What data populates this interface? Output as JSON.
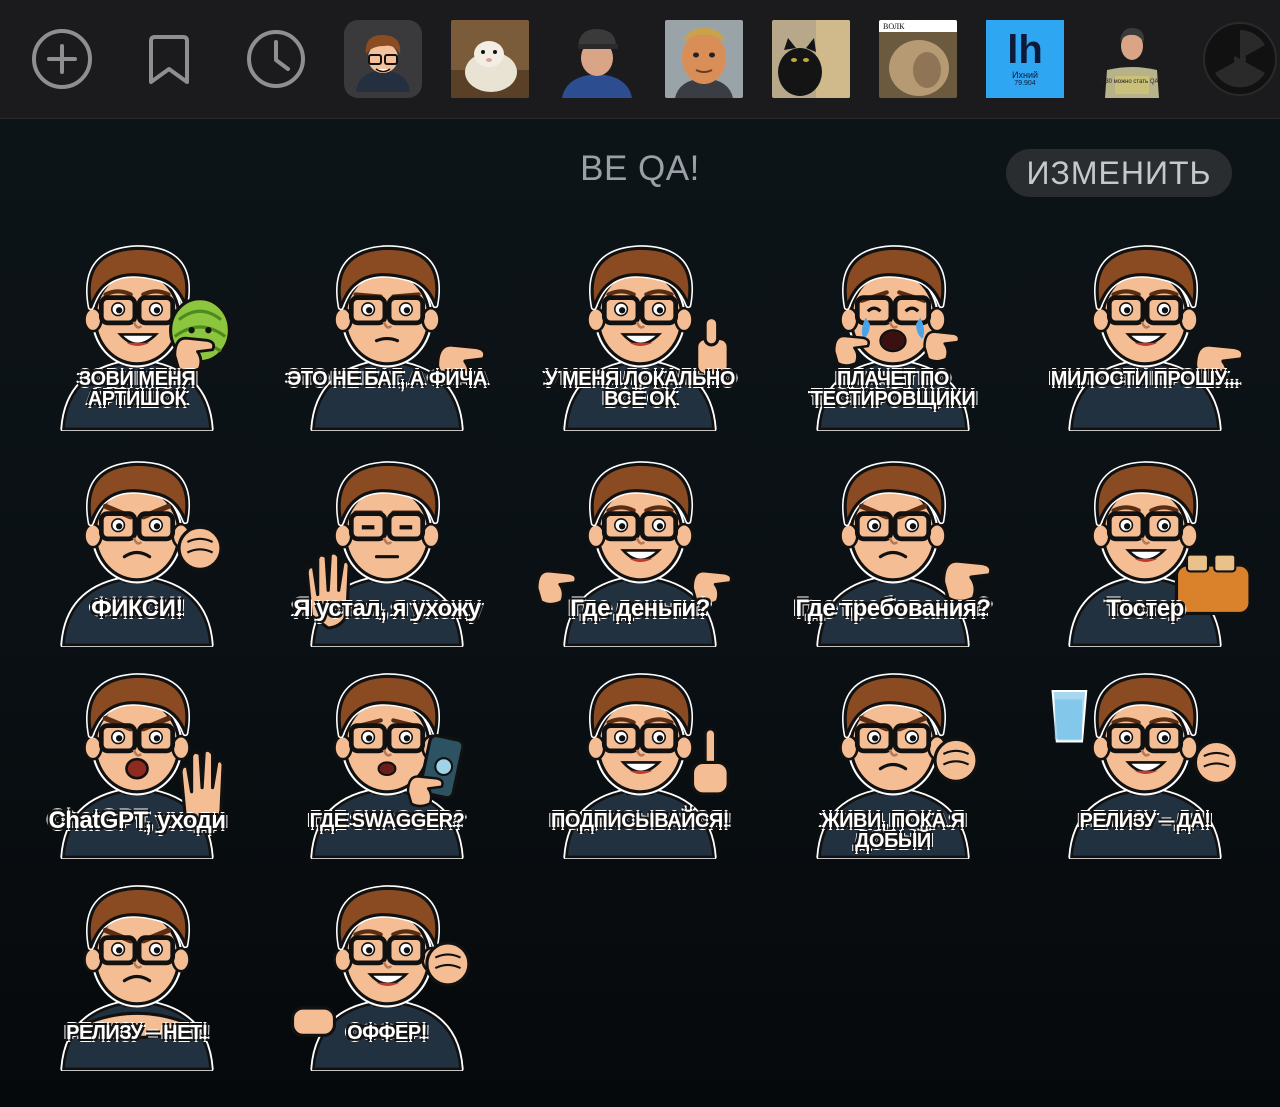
{
  "toolbar": {
    "items": [
      {
        "name": "add-pack-icon",
        "kind": "icon"
      },
      {
        "name": "saved-stickers-icon",
        "kind": "icon"
      },
      {
        "name": "recent-stickers-icon",
        "kind": "icon"
      },
      {
        "name": "pack-be-qa",
        "kind": "pack"
      },
      {
        "name": "pack-opossum",
        "kind": "pack"
      },
      {
        "name": "pack-man-cap",
        "kind": "pack"
      },
      {
        "name": "pack-mr-incredible",
        "kind": "pack"
      },
      {
        "name": "pack-cats",
        "kind": "pack"
      },
      {
        "name": "pack-wolf",
        "kind": "pack"
      },
      {
        "name": "pack-lh",
        "kind": "pack"
      },
      {
        "name": "pack-qa-man",
        "kind": "pack"
      },
      {
        "name": "radiation-icon",
        "kind": "icon"
      }
    ],
    "wolf_label": "ВОЛК",
    "lh_symbol": "lh",
    "lh_name": "Ихний",
    "lh_number": "79.904",
    "qa_shirt_text": "в 30 можно стать QA?!"
  },
  "pack": {
    "title": "BE QA!",
    "edit_label": "ИЗМЕНИТЬ"
  },
  "stickers": [
    {
      "caption": "ЗОВИ МЕНЯ АРТИШОК",
      "style": "upper",
      "prop": "artichoke",
      "mood": "happy"
    },
    {
      "caption": "ЭТО НЕ БАГ, А ФИЧА",
      "style": "upper",
      "prop": "palm",
      "mood": "neutral"
    },
    {
      "caption": "У МЕНЯ ЛОКАЛЬНО ВСЁ ОК",
      "style": "upper",
      "prop": "thumb",
      "mood": "happy"
    },
    {
      "caption": "ПЛАЧЕТ ПО ТЕСТИРОВЩИКИ",
      "style": "upper",
      "prop": "hands",
      "mood": "cry"
    },
    {
      "caption": "МИЛОСТИ ПРОШУ...",
      "style": "upper",
      "prop": "palm",
      "mood": "happy"
    },
    {
      "caption": "ФИКСИ!",
      "style": "lower",
      "prop": "fist",
      "mood": "angry"
    },
    {
      "caption": "Я устал, я ухожу",
      "style": "lower",
      "prop": "wave",
      "mood": "tired"
    },
    {
      "caption": "Где деньги?",
      "style": "lower",
      "prop": "shrug",
      "mood": "happy"
    },
    {
      "caption": "Где требования?",
      "style": "lower",
      "prop": "palm",
      "mood": "angry"
    },
    {
      "caption": "Тостер",
      "style": "lower",
      "prop": "toaster",
      "mood": "happy"
    },
    {
      "caption": "ChatGPT, уходи",
      "style": "lower",
      "prop": "stop",
      "mood": "shout"
    },
    {
      "caption": "ГДЕ SWAGGER?",
      "style": "mid",
      "prop": "phone",
      "mood": "worried"
    },
    {
      "caption": "ПОДПИСЫВАЙСЯ!",
      "style": "mid",
      "prop": "finger",
      "mood": "happy"
    },
    {
      "caption": "ЖИВИ, ПОКА Я ДОБЫЙ",
      "style": "mid",
      "prop": "fist",
      "mood": "angry"
    },
    {
      "caption": "РЕЛИЗУ – ДА!",
      "style": "mid",
      "prop": "glass",
      "mood": "happy"
    },
    {
      "caption": "РЕЛИЗУ – НЕТ!",
      "style": "mid",
      "prop": "arms",
      "mood": "angry"
    },
    {
      "caption": "ОФФЕР!",
      "style": "mid",
      "prop": "point",
      "mood": "happy"
    }
  ]
}
